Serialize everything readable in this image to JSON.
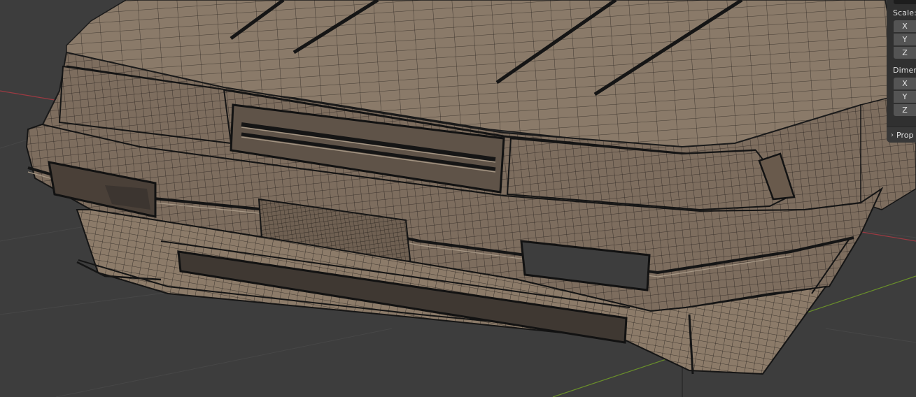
{
  "app": {
    "name": "Blender 3D Viewport",
    "object": "car-front-bumper-wireframe"
  },
  "colors": {
    "viewport_bg": "#3d3d3d",
    "grid_line": "#4a4a4a",
    "axis_x": "#9c3a42",
    "axis_y": "#6a8f2a",
    "mesh_fill": "#7d6d5e",
    "mesh_wire": "#1a1a1a",
    "panel_bg": "#303030",
    "field_bg": "#545454"
  },
  "sidebar": {
    "scale": {
      "label": "Scale:",
      "fields": [
        {
          "axis": "X"
        },
        {
          "axis": "Y"
        },
        {
          "axis": "Z"
        }
      ]
    },
    "dimensions": {
      "label": "Dimen",
      "fields": [
        {
          "axis": "X"
        },
        {
          "axis": "Y"
        },
        {
          "axis": "Z"
        }
      ]
    },
    "properties_section": {
      "label": "Prop",
      "icon": "chevron-right-icon"
    }
  }
}
